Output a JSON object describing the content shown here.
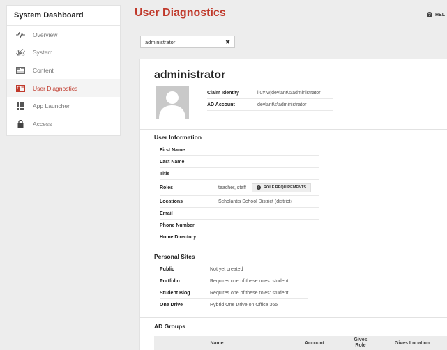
{
  "sidebar": {
    "title": "System Dashboard",
    "items": [
      {
        "label": "Overview",
        "icon": "pulse-icon"
      },
      {
        "label": "System",
        "icon": "gears-icon"
      },
      {
        "label": "Content",
        "icon": "content-icon"
      },
      {
        "label": "User Diagnostics",
        "icon": "id-card-icon",
        "active": true
      },
      {
        "label": "App Launcher",
        "icon": "grid-icon"
      },
      {
        "label": "Access",
        "icon": "lock-icon"
      }
    ]
  },
  "header": {
    "title": "User Diagnostics",
    "help_label": "HEL"
  },
  "search": {
    "value": "administrator",
    "clear_glyph": "✖"
  },
  "user": {
    "name": "administrator",
    "claim_identity_label": "Claim Identity",
    "claim_identity_value": "i:0#.w|devlant\\s\\administrator",
    "ad_account_label": "AD Account",
    "ad_account_value": "devlant\\s\\administrator"
  },
  "user_info": {
    "title": "User Information",
    "first_name_label": "First Name",
    "last_name_label": "Last Name",
    "title_label": "Title",
    "roles_label": "Roles",
    "roles_value": "teacher, staff",
    "role_requirements_button": "ROLE REQUIREMENTS",
    "locations_label": "Locations",
    "locations_value": "Scholantis School District (district)",
    "email_label": "Email",
    "phone_label": "Phone Number",
    "home_dir_label": "Home Directory"
  },
  "personal_sites": {
    "title": "Personal Sites",
    "rows": [
      {
        "label": "Public",
        "value": "Not yet created"
      },
      {
        "label": "Portfolio",
        "value": "Requires one of these roles: student"
      },
      {
        "label": "Student Blog",
        "value": "Requires one of these roles: student"
      },
      {
        "label": "One Drive",
        "value": "Hybrid One Drive on Office 365"
      }
    ]
  },
  "ad_groups": {
    "title": "AD Groups",
    "col_name": "Name",
    "col_account": "Account",
    "col_gives_role": "Gives Role",
    "col_gives_location": "Gives Location"
  },
  "colors": {
    "accent": "#c0392b",
    "background": "#ededed"
  }
}
